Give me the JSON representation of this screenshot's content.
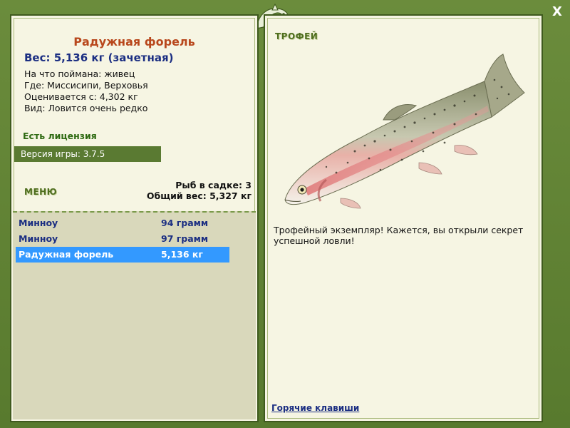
{
  "window": {
    "close_label": "X"
  },
  "fish_card": {
    "title": "Радужная форель",
    "weight": "Вес: 5,136 кг (зачетная)",
    "bait_line": "На что поймана: живец",
    "location_line": "Где: Миссисипи, Верховья",
    "value_line": "Оценивается с: 4,302 кг",
    "rarity_line": "Вид: Ловится очень редко"
  },
  "license": {
    "text": "Есть лицензия"
  },
  "version": {
    "text": "Версия игры: 3.7.5"
  },
  "menu": {
    "label": "МЕНЮ"
  },
  "keepnet": {
    "count_text": "Рыб в садке: 3",
    "total_text": "Общий вес: 5,327 кг"
  },
  "catch_list": [
    {
      "name": "Минноу",
      "weight": "94 грамм",
      "selected": false
    },
    {
      "name": "Минноу",
      "weight": "97 грамм",
      "selected": false
    },
    {
      "name": "Радужная форель",
      "weight": "5,136 кг",
      "selected": true
    }
  ],
  "trophy": {
    "label": "ТРОФЕЙ",
    "message": "Трофейный экземпляр! Кажется, вы открыли секрет успешной ловли!"
  },
  "footer": {
    "hotkeys_link": "Горячие клавиши"
  },
  "colors": {
    "frame_green": "#5a7a32",
    "panel_bg": "#f6f5e3",
    "title_orange": "#b8471c",
    "weight_blue": "#1b2e82",
    "license_green": "#2e6a12",
    "selection_blue": "#3399ff"
  },
  "icons": {
    "logo": "leaping-fish-logo",
    "fish": "rainbow-trout-image"
  }
}
